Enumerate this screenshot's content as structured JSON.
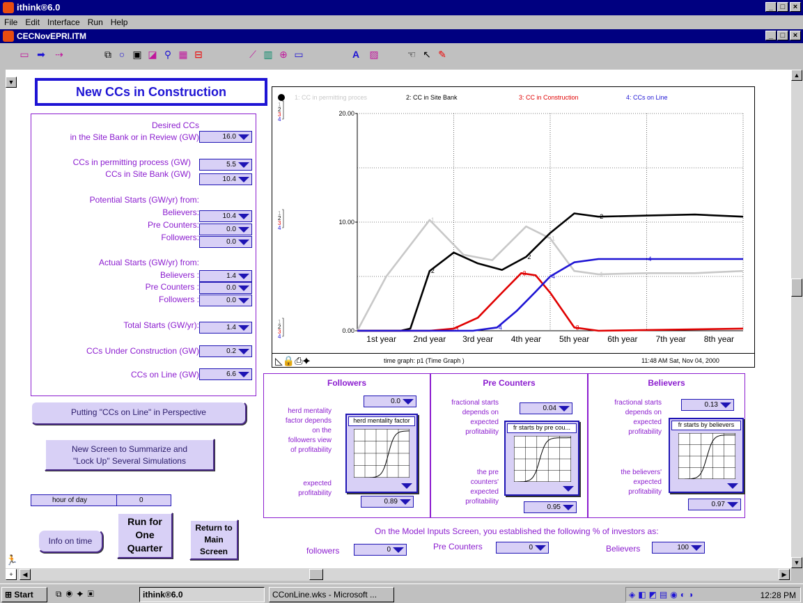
{
  "app": {
    "title": "ithink®6.0",
    "doc_title": "CECNovEPRI.ITM"
  },
  "menu": [
    "File",
    "Edit",
    "Interface",
    "Run",
    "Help"
  ],
  "window_buttons": {
    "min": "_",
    "max": "□",
    "close": "×"
  },
  "header_title": "New CCs in Construction",
  "inputs": {
    "desired1": "Desired CCs",
    "desired2": "in the Site Bank or in Review (GW)",
    "desired_val": "16.0",
    "permit_lbl": "CCs in permitting process (GW)",
    "permit_val": "5.5",
    "sitebank_lbl": "CCs in Site Bank (GW)",
    "sitebank_val": "10.4",
    "potential_lbl": "Potential Starts (GW/yr) from:",
    "pot_bel_lbl": "Believers:",
    "pot_bel_val": "10.4",
    "pot_pre_lbl": "Pre Counters:",
    "pot_pre_val": "0.0",
    "pot_fol_lbl": "Followers:",
    "pot_fol_val": "0.0",
    "actual_lbl": "Actual Starts (GW/yr) from:",
    "act_bel_lbl": "Believers :",
    "act_bel_val": "1.4",
    "act_pre_lbl": "Pre Counters :",
    "act_pre_val": "0.0",
    "act_fol_lbl": "Followers :",
    "act_fol_val": "0.0",
    "total_lbl": "Total  Starts (GW/yr):",
    "total_val": "1.4",
    "under_lbl": "CCs Under Construction (GW)",
    "under_val": "0.2",
    "online_lbl": "CCs on Line (GW)",
    "online_val": "6.6"
  },
  "buttons": {
    "perspective": "Putting \"CCs on Line\" in Perspective",
    "summarize1": "New Screen to Summarize and",
    "summarize2": "\"Lock Up\" Several Simulations",
    "info": "Info on time",
    "run1": "Run for",
    "run2": "One",
    "run3": "Quarter",
    "ret1": "Return to",
    "ret2": "Main",
    "ret3": "Screen"
  },
  "hour": {
    "label": "hour of day",
    "value": "0"
  },
  "graph": {
    "legend": [
      "1: CC in permitting proces",
      "2: CC in Site Bank",
      "3: CC in Construction",
      "4: CCs on Line"
    ],
    "footer_left": "time graph: p1 (Time Graph )",
    "footer_right": "11:48 AM  Sat, Nov 04, 2000",
    "scale_nums": [
      "1",
      "2",
      "3",
      "4"
    ]
  },
  "chart_data": {
    "type": "line",
    "x_categories": [
      "1st year",
      "2nd year",
      "3rd year",
      "4th year",
      "5th year",
      "6th year",
      "7th year",
      "8th year"
    ],
    "ylim": [
      0,
      20
    ],
    "y_ticks": [
      "20.00",
      "10.00",
      "0.00"
    ],
    "series": [
      {
        "name": "1: CC in permitting proces",
        "color": "#c8c8c8",
        "x": [
          0,
          0.6,
          1.5,
          2.2,
          2.8,
          3.5,
          4,
          4.5,
          5,
          6,
          7,
          8
        ],
        "y": [
          0,
          5,
          10.2,
          7,
          6.5,
          9.6,
          8.5,
          5.5,
          5.2,
          5.3,
          5.3,
          5.5
        ]
      },
      {
        "name": "2: CC in Site Bank",
        "color": "#000000",
        "x": [
          0,
          0.9,
          1.1,
          1.5,
          2,
          2.5,
          3,
          3.5,
          4,
          4.5,
          5,
          6,
          7,
          8
        ],
        "y": [
          0,
          0,
          0.2,
          5.5,
          7.2,
          6.2,
          5.6,
          6.8,
          9,
          10.8,
          10.5,
          10.6,
          10.7,
          10.5
        ]
      },
      {
        "name": "3: CC in Construction",
        "color": "#e00000",
        "x": [
          0,
          1.5,
          2,
          2.5,
          3,
          3.4,
          3.7,
          4,
          4.5,
          5,
          8
        ],
        "y": [
          0,
          0,
          0.2,
          1.2,
          3.5,
          5.3,
          5.1,
          3.5,
          0.3,
          0,
          0.2
        ]
      },
      {
        "name": "4: CCs on Line",
        "color": "#1e14d4",
        "x": [
          0,
          2.4,
          2.9,
          3.3,
          3.7,
          4,
          4.5,
          5,
          6,
          7,
          8
        ],
        "y": [
          0,
          0,
          0.3,
          1.8,
          3.6,
          5,
          6.3,
          6.6,
          6.6,
          6.6,
          6.6
        ]
      }
    ]
  },
  "followers": {
    "title": "Followers",
    "val_top": "0.0",
    "desc": [
      "herd mentality",
      "factor depends",
      "on the",
      "followers view",
      "of profitability"
    ],
    "gtitle": "herd mentality factor",
    "exp": [
      "expected",
      "profitability"
    ],
    "val_bottom": "0.89"
  },
  "precounters": {
    "title": "Pre Counters",
    "val_top": "0.04",
    "desc": [
      "fractional starts",
      "depends on",
      "expected",
      "profitability"
    ],
    "gtitle": "fr starts by pre cou...",
    "exp": [
      "the pre",
      "counters'",
      "expected",
      "profitability"
    ],
    "val_bottom": "0.95"
  },
  "believers": {
    "title": "Believers",
    "val_top": "0.13",
    "desc": [
      "fractional starts",
      "depends on",
      "expected",
      "profitability"
    ],
    "gtitle": "fr starts by believers",
    "exp": [
      "the believers'",
      "expected",
      "profitability"
    ],
    "val_bottom": "0.97"
  },
  "investors": {
    "note": "On the Model Inputs Screen, you established the following % of investors as:",
    "fol_lbl": "followers",
    "fol_val": "0",
    "pre_lbl": "Pre Counters",
    "pre_val": "0",
    "bel_lbl": "Believers",
    "bel_val": "100"
  },
  "taskbar": {
    "start": "Start",
    "ithink": "ithink®6.0",
    "wks": "CConLine.wks - Microsoft ...",
    "clock": "12:28 PM"
  }
}
